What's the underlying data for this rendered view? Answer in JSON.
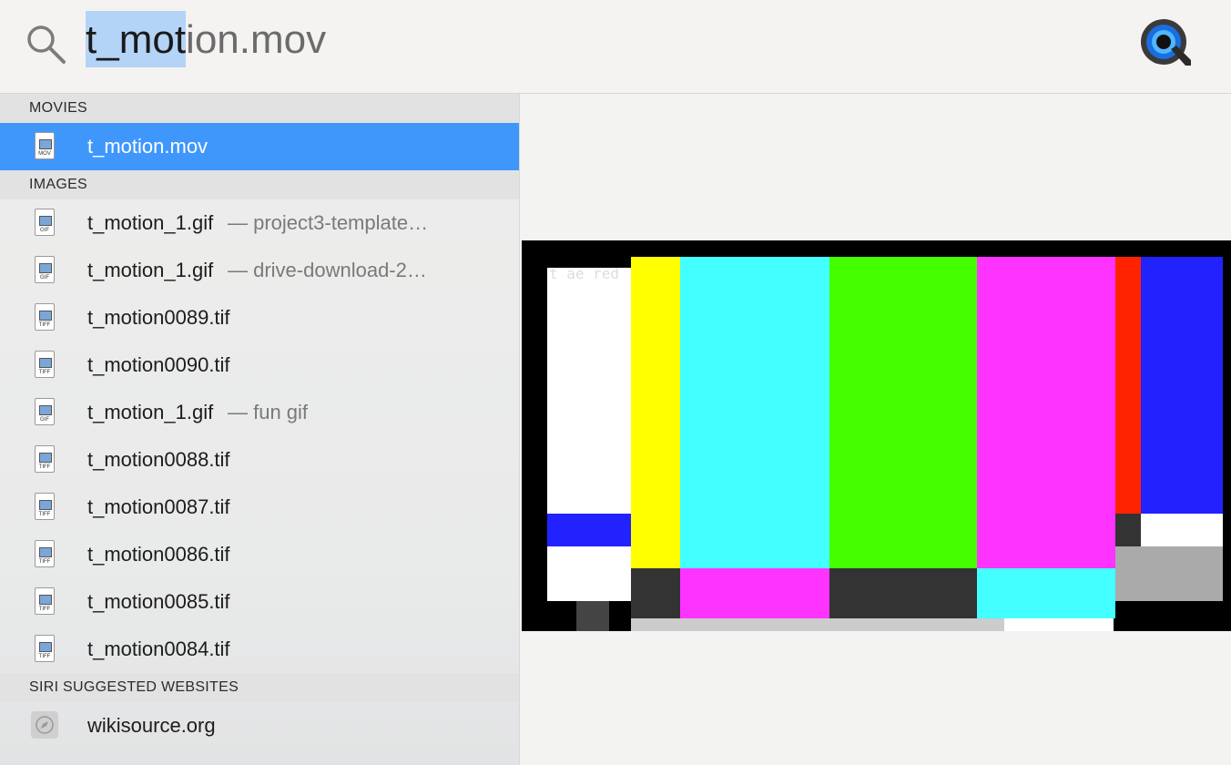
{
  "search": {
    "query": "t_motion.mov",
    "query_selected": "t_mot",
    "query_rest": "ion.mov"
  },
  "sections": {
    "movies": "MOVIES",
    "images": "IMAGES",
    "siri": "SIRI SUGGESTED WEBSITES"
  },
  "movies": [
    {
      "name": "t_motion.mov",
      "icon_tag": "MOV",
      "selected": true
    }
  ],
  "images": [
    {
      "name": "t_motion_1.gif",
      "sub": "— project3-template…",
      "icon_tag": "GIF"
    },
    {
      "name": "t_motion_1.gif",
      "sub": "— drive-download-2…",
      "icon_tag": "GIF"
    },
    {
      "name": "t_motion0089.tif",
      "sub": "",
      "icon_tag": "TIFF"
    },
    {
      "name": "t_motion0090.tif",
      "sub": "",
      "icon_tag": "TIFF"
    },
    {
      "name": "t_motion_1.gif",
      "sub": "— fun gif",
      "icon_tag": "GIF"
    },
    {
      "name": "t_motion0088.tif",
      "sub": "",
      "icon_tag": "TIFF"
    },
    {
      "name": "t_motion0087.tif",
      "sub": "",
      "icon_tag": "TIFF"
    },
    {
      "name": "t_motion0086.tif",
      "sub": "",
      "icon_tag": "TIFF"
    },
    {
      "name": "t_motion0085.tif",
      "sub": "",
      "icon_tag": "TIFF"
    },
    {
      "name": "t_motion0084.tif",
      "sub": "",
      "icon_tag": "TIFF"
    }
  ],
  "websites": [
    {
      "name": "wikisource.org",
      "icon": "compass-icon"
    }
  ],
  "preview": {
    "overlay_text": "t ae red",
    "bar_colors": [
      "#ffffff",
      "#ffff00",
      "#44ffff",
      "#44ff00",
      "#ff33ff",
      "#ff2200",
      "#2222ff"
    ]
  },
  "colors": {
    "selection": "#3f97fc",
    "query_highlight": "#b3d4f6"
  }
}
